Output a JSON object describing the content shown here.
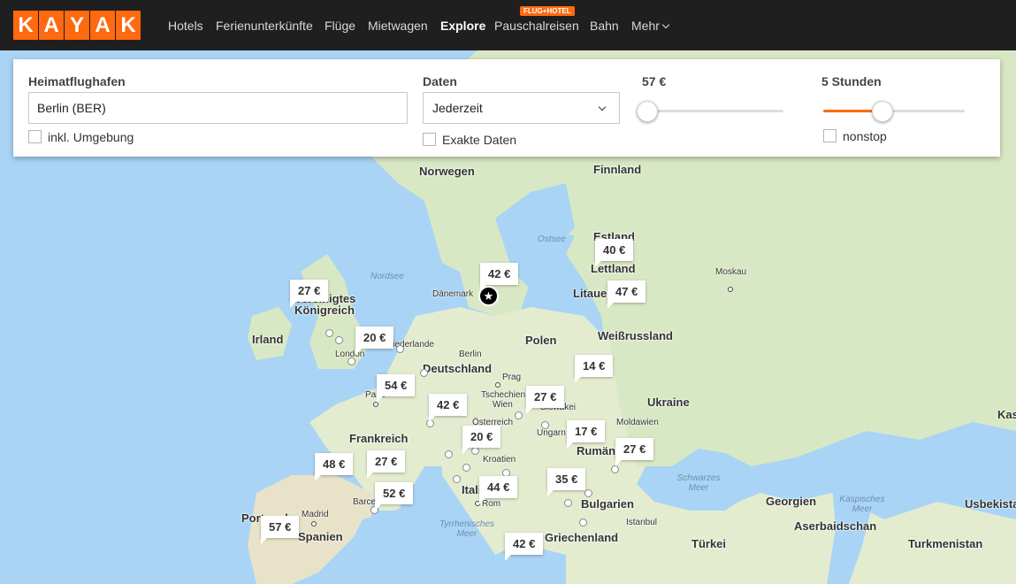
{
  "brand": {
    "letters": [
      "K",
      "A",
      "Y",
      "A",
      "K"
    ],
    "accent": "#ff690f"
  },
  "nav": {
    "items": [
      "Hotels",
      "Ferienunterkünfte",
      "Flüge",
      "Mietwagen",
      "Explore",
      "Pauschalreisen",
      "Bahn",
      "Mehr"
    ],
    "active": "Explore",
    "badge": "FLUG+HOTEL"
  },
  "panel": {
    "origin_label": "Heimatflughafen",
    "origin_value": "Berlin (BER)",
    "nearby_label": "inkl. Umgebung",
    "dates_label": "Daten",
    "dates_value": "Jederzeit",
    "exact_label": "Exakte Daten",
    "price_label": "57 €",
    "price_level": 0.0,
    "duration_label": "5 Stunden",
    "duration_level": 0.43,
    "nonstop_label": "nonstop"
  },
  "map": {
    "countries": [
      "Norwegen",
      "Finnland",
      "Estland",
      "Lettland",
      "Litauen",
      "Dänemark",
      "Vereinigtes Königreich",
      "Irland",
      "Niederlande",
      "Deutschland",
      "Polen",
      "Weißrussland",
      "Tschechien",
      "Slowakei",
      "Österreich",
      "Ukraine",
      "Frankreich",
      "Ungarn",
      "Moldawien",
      "Rumänien",
      "Kroatien",
      "Italien",
      "Bulgarien",
      "Spanien",
      "Portugal",
      "Griechenland",
      "Türkei",
      "Georgien",
      "Aserbaidschan",
      "Turkmenistan",
      "Usbekistan",
      "Kasachstan"
    ],
    "cities": [
      "Moskau",
      "London",
      "Paris",
      "Berlin",
      "Prag",
      "Wien",
      "Madrid",
      "Barcelona",
      "Rom",
      "Istanbul"
    ],
    "seas": [
      "Nordsee",
      "Ostsee",
      "Schwarzes Meer",
      "Tyrrhenisches Meer",
      "Kaspisches Meer"
    ],
    "prices": [
      "27 €",
      "20 €",
      "54 €",
      "42 €",
      "42 €",
      "40 €",
      "47 €",
      "14 €",
      "27 €",
      "20 €",
      "17 €",
      "27 €",
      "48 €",
      "27 €",
      "52 €",
      "44 €",
      "35 €",
      "57 €",
      "42 €"
    ]
  }
}
